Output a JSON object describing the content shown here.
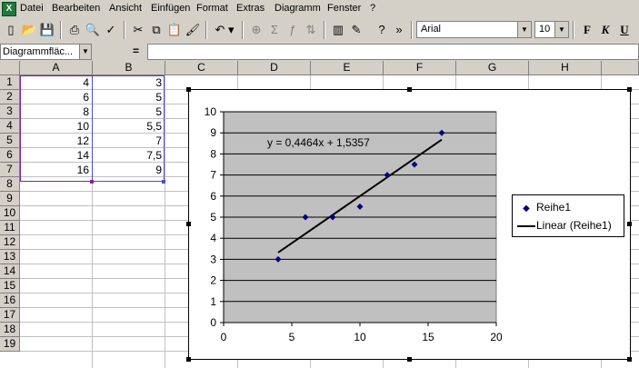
{
  "app_icon": "X",
  "menu": [
    "Datei",
    "Bearbeiten",
    "Ansicht",
    "Einfügen",
    "Format",
    "Extras",
    "Diagramm",
    "Fenster",
    "?"
  ],
  "toolbar": {
    "font_name": "Arial",
    "font_size": "10",
    "bold_label": "F",
    "italic_label": "K",
    "underline_label": "U",
    "more_label": "»"
  },
  "formula_bar": {
    "name_box": "Diagrammfläc...",
    "equals": "=",
    "content": ""
  },
  "columns": [
    "A",
    "B",
    "C",
    "D",
    "E",
    "F",
    "G",
    "H"
  ],
  "rows": [
    "1",
    "2",
    "3",
    "4",
    "5",
    "6",
    "7",
    "8",
    "9",
    "10",
    "11",
    "12",
    "13",
    "14",
    "15",
    "16",
    "17",
    "18",
    "19"
  ],
  "cells": {
    "A": [
      "4",
      "6",
      "8",
      "10",
      "12",
      "14",
      "16"
    ],
    "B": [
      "3",
      "5",
      "5",
      "5,5",
      "7",
      "7,5",
      "9"
    ]
  },
  "chart_data": {
    "type": "scatter",
    "x": [
      4,
      6,
      8,
      10,
      12,
      14,
      16
    ],
    "series": [
      {
        "name": "Reihe1",
        "values": [
          3,
          5,
          5,
          5.5,
          7,
          7.5,
          9
        ],
        "marker": "diamond",
        "color": "#000080"
      }
    ],
    "trendline": {
      "name": "Linear (Reihe1)",
      "slope": 0.4464,
      "intercept": 1.5357,
      "x_range": [
        4,
        16
      ],
      "color": "#000000"
    },
    "equation_label": "y = 0,4464x + 1,5357",
    "xlim": [
      0,
      20
    ],
    "ylim": [
      0,
      10
    ],
    "x_ticks": [
      "0",
      "5",
      "10",
      "15",
      "20"
    ],
    "y_ticks": [
      "0",
      "1",
      "2",
      "3",
      "4",
      "5",
      "6",
      "7",
      "8",
      "9",
      "10"
    ],
    "plot_background": "#c0c0c0",
    "grid": true,
    "legend_position": "right"
  },
  "colors": {
    "selection_a": "#8a1fa0",
    "selection_b": "#4b4bdc",
    "chrome": "#d4d0c8"
  }
}
